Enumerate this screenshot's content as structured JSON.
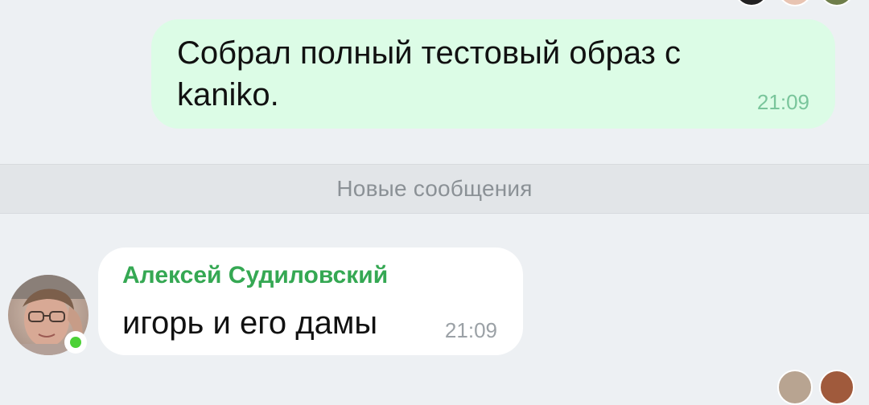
{
  "messages": {
    "outgoing": {
      "text": "Собрал полный тестовый образ с kaniko.",
      "time": "21:09"
    },
    "divider_label": "Новые сообщения",
    "incoming": {
      "sender": "Алексей Судиловский",
      "text": "игорь и его дамы",
      "time": "21:09",
      "avatar_icon": "user-avatar-photo",
      "online": true
    }
  },
  "colors": {
    "background": "#edf0f3",
    "outgoing_bubble": "#dcfce6",
    "incoming_bubble": "#ffffff",
    "sender_name": "#35a853",
    "online_indicator": "#4cd137"
  }
}
